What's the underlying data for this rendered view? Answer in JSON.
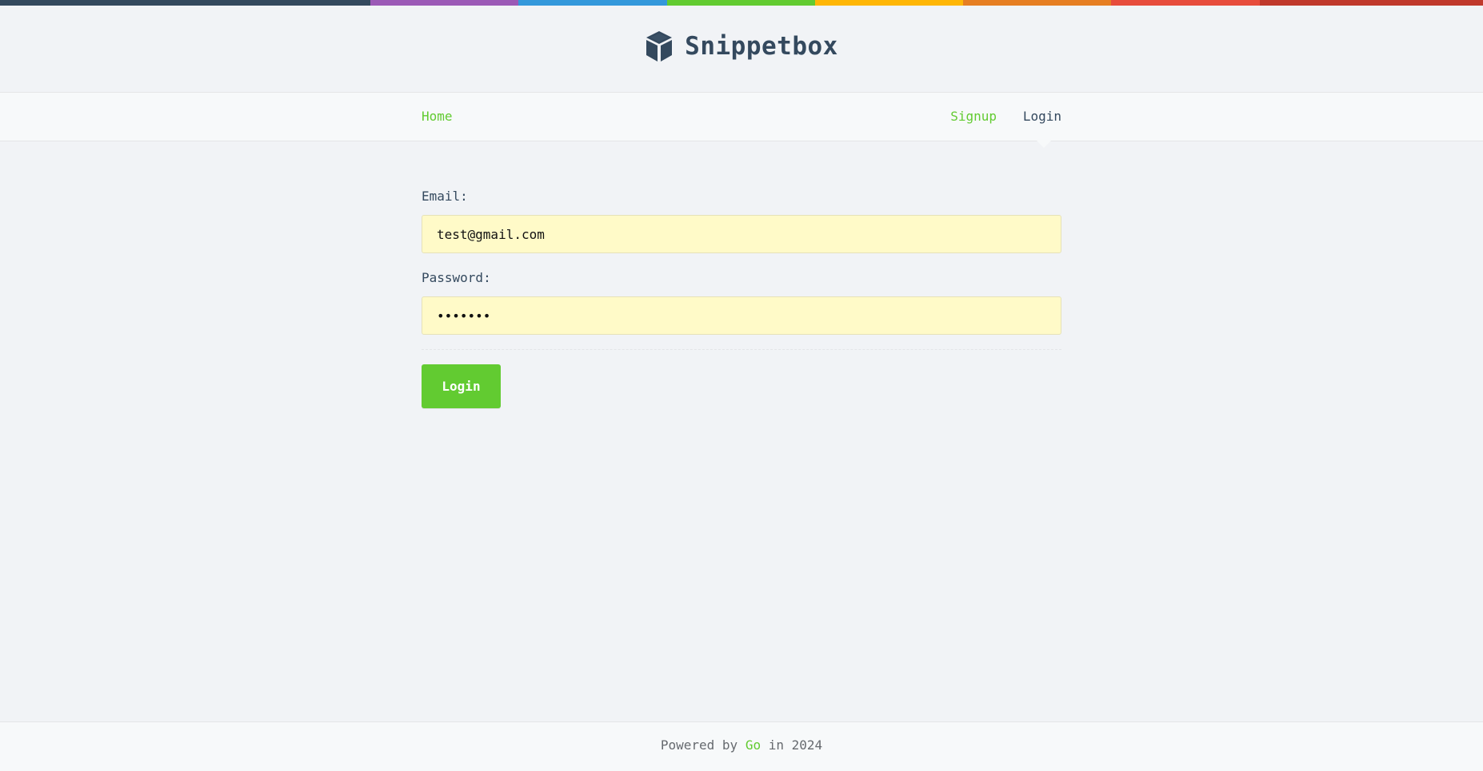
{
  "theme": {
    "accent": "#62cb31",
    "text": "#34495e",
    "background": "#f1f3f6",
    "input_autofill": "#fffac8",
    "stripe_colors": [
      "#34495e",
      "#9b59b6",
      "#3498db",
      "#62cb31",
      "#ffb606",
      "#e67e22",
      "#e74c3c",
      "#c0392b"
    ]
  },
  "header": {
    "logo_icon": "cube-icon",
    "brand": "Snippetbox"
  },
  "nav": {
    "home": "Home",
    "signup": "Signup",
    "login": "Login",
    "active": "Login"
  },
  "form": {
    "email_label": "Email:",
    "email_value": "test@gmail.com",
    "password_label": "Password:",
    "password_value": "•••••••",
    "submit_label": "Login"
  },
  "footer": {
    "prefix": "Powered by",
    "link": "Go",
    "suffix": "in 2024"
  }
}
